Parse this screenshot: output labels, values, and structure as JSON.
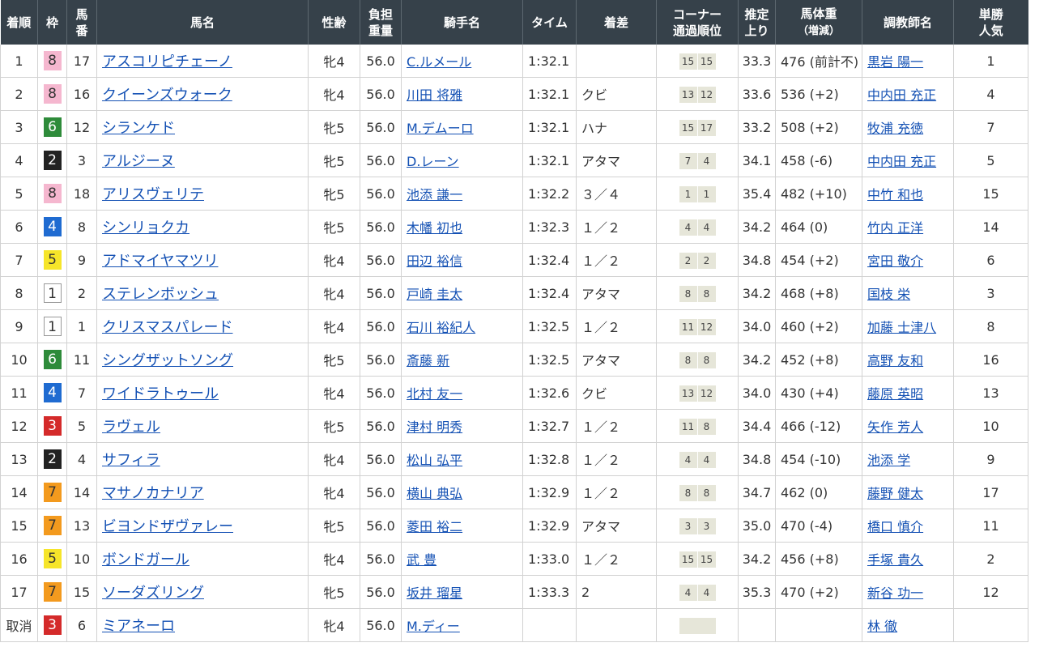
{
  "headers": {
    "rank": "着順",
    "waku": "枠",
    "num_l1": "馬",
    "num_l2": "番",
    "horse": "馬名",
    "sexage": "性齢",
    "weight_l1": "負担",
    "weight_l2": "重量",
    "jockey": "騎手名",
    "time": "タイム",
    "margin": "着差",
    "corner_l1": "コーナー",
    "corner_l2": "通過順位",
    "last3f_l1": "推定",
    "last3f_l2": "上り",
    "bodyweight_l1": "馬体重",
    "bodyweight_l2": "（増減）",
    "trainer": "調教師名",
    "pop_l1": "単勝",
    "pop_l2": "人気"
  },
  "rows": [
    {
      "rank": "1",
      "waku": "8",
      "num": "17",
      "horse": "アスコリピチェーノ",
      "sexage": "牝4",
      "weight": "56.0",
      "jockey": "C.ルメール",
      "time": "1:32.1",
      "margin": "",
      "c1": "15",
      "c2": "15",
      "last3f": "33.3",
      "bodyweight": "476 (前計不)",
      "trainer": "黒岩 陽一",
      "pop": "1"
    },
    {
      "rank": "2",
      "waku": "8",
      "num": "16",
      "horse": "クイーンズウォーク",
      "sexage": "牝4",
      "weight": "56.0",
      "jockey": "川田 将雅",
      "time": "1:32.1",
      "margin": "クビ",
      "c1": "13",
      "c2": "12",
      "last3f": "33.6",
      "bodyweight": "536 (+2)",
      "trainer": "中内田 充正",
      "pop": "4"
    },
    {
      "rank": "3",
      "waku": "6",
      "num": "12",
      "horse": "シランケド",
      "sexage": "牝5",
      "weight": "56.0",
      "jockey": "M.デムーロ",
      "time": "1:32.1",
      "margin": "ハナ",
      "c1": "15",
      "c2": "17",
      "last3f": "33.2",
      "bodyweight": "508 (+2)",
      "trainer": "牧浦 充徳",
      "pop": "7"
    },
    {
      "rank": "4",
      "waku": "2",
      "num": "3",
      "horse": "アルジーヌ",
      "sexage": "牝5",
      "weight": "56.0",
      "jockey": "D.レーン",
      "time": "1:32.1",
      "margin": "アタマ",
      "c1": "7",
      "c2": "4",
      "last3f": "34.1",
      "bodyweight": "458 (-6)",
      "trainer": "中内田 充正",
      "pop": "5"
    },
    {
      "rank": "5",
      "waku": "8",
      "num": "18",
      "horse": "アリスヴェリテ",
      "sexage": "牝5",
      "weight": "56.0",
      "jockey": "池添 謙一",
      "time": "1:32.2",
      "margin": "３／４",
      "c1": "1",
      "c2": "1",
      "last3f": "35.4",
      "bodyweight": "482 (+10)",
      "trainer": "中竹 和也",
      "pop": "15"
    },
    {
      "rank": "6",
      "waku": "4",
      "num": "8",
      "horse": "シンリョクカ",
      "sexage": "牝5",
      "weight": "56.0",
      "jockey": "木幡 初也",
      "time": "1:32.3",
      "margin": "１／２",
      "c1": "4",
      "c2": "4",
      "last3f": "34.2",
      "bodyweight": "464 (0)",
      "trainer": "竹内 正洋",
      "pop": "14"
    },
    {
      "rank": "7",
      "waku": "5",
      "num": "9",
      "horse": "アドマイヤマツリ",
      "sexage": "牝4",
      "weight": "56.0",
      "jockey": "田辺 裕信",
      "time": "1:32.4",
      "margin": "１／２",
      "c1": "2",
      "c2": "2",
      "last3f": "34.8",
      "bodyweight": "454 (+2)",
      "trainer": "宮田 敬介",
      "pop": "6"
    },
    {
      "rank": "8",
      "waku": "1",
      "num": "2",
      "horse": "ステレンボッシュ",
      "sexage": "牝4",
      "weight": "56.0",
      "jockey": "戸崎 圭太",
      "time": "1:32.4",
      "margin": "アタマ",
      "c1": "8",
      "c2": "8",
      "last3f": "34.2",
      "bodyweight": "468 (+8)",
      "trainer": "国枝 栄",
      "pop": "3"
    },
    {
      "rank": "9",
      "waku": "1",
      "num": "1",
      "horse": "クリスマスパレード",
      "sexage": "牝4",
      "weight": "56.0",
      "jockey": "石川 裕紀人",
      "time": "1:32.5",
      "margin": "１／２",
      "c1": "11",
      "c2": "12",
      "last3f": "34.0",
      "bodyweight": "460 (+2)",
      "trainer": "加藤 士津八",
      "pop": "8"
    },
    {
      "rank": "10",
      "waku": "6",
      "num": "11",
      "horse": "シングザットソング",
      "sexage": "牝5",
      "weight": "56.0",
      "jockey": "斎藤 新",
      "time": "1:32.5",
      "margin": "アタマ",
      "c1": "8",
      "c2": "8",
      "last3f": "34.2",
      "bodyweight": "452 (+8)",
      "trainer": "高野 友和",
      "pop": "16"
    },
    {
      "rank": "11",
      "waku": "4",
      "num": "7",
      "horse": "ワイドラトゥール",
      "sexage": "牝4",
      "weight": "56.0",
      "jockey": "北村 友一",
      "time": "1:32.6",
      "margin": "クビ",
      "c1": "13",
      "c2": "12",
      "last3f": "34.0",
      "bodyweight": "430 (+4)",
      "trainer": "藤原 英昭",
      "pop": "13"
    },
    {
      "rank": "12",
      "waku": "3",
      "num": "5",
      "horse": "ラヴェル",
      "sexage": "牝5",
      "weight": "56.0",
      "jockey": "津村 明秀",
      "time": "1:32.7",
      "margin": "１／２",
      "c1": "11",
      "c2": "8",
      "last3f": "34.4",
      "bodyweight": "466 (-12)",
      "trainer": "矢作 芳人",
      "pop": "10"
    },
    {
      "rank": "13",
      "waku": "2",
      "num": "4",
      "horse": "サフィラ",
      "sexage": "牝4",
      "weight": "56.0",
      "jockey": "松山 弘平",
      "time": "1:32.8",
      "margin": "１／２",
      "c1": "4",
      "c2": "4",
      "last3f": "34.8",
      "bodyweight": "454 (-10)",
      "trainer": "池添 学",
      "pop": "9"
    },
    {
      "rank": "14",
      "waku": "7",
      "num": "14",
      "horse": "マサノカナリア",
      "sexage": "牝4",
      "weight": "56.0",
      "jockey": "横山 典弘",
      "time": "1:32.9",
      "margin": "１／２",
      "c1": "8",
      "c2": "8",
      "last3f": "34.7",
      "bodyweight": "462 (0)",
      "trainer": "藤野 健太",
      "pop": "17"
    },
    {
      "rank": "15",
      "waku": "7",
      "num": "13",
      "horse": "ビヨンドザヴァレー",
      "sexage": "牝5",
      "weight": "56.0",
      "jockey": "菱田 裕二",
      "time": "1:32.9",
      "margin": "アタマ",
      "c1": "3",
      "c2": "3",
      "last3f": "35.0",
      "bodyweight": "470 (-4)",
      "trainer": "橋口 慎介",
      "pop": "11"
    },
    {
      "rank": "16",
      "waku": "5",
      "num": "10",
      "horse": "ボンドガール",
      "sexage": "牝4",
      "weight": "56.0",
      "jockey": "武 豊",
      "time": "1:33.0",
      "margin": "１／２",
      "c1": "15",
      "c2": "15",
      "last3f": "34.2",
      "bodyweight": "456 (+8)",
      "trainer": "手塚 貴久",
      "pop": "2"
    },
    {
      "rank": "17",
      "waku": "7",
      "num": "15",
      "horse": "ソーダズリング",
      "sexage": "牝5",
      "weight": "56.0",
      "jockey": "坂井 瑠星",
      "time": "1:33.3",
      "margin": "2",
      "c1": "4",
      "c2": "4",
      "last3f": "35.3",
      "bodyweight": "470 (+2)",
      "trainer": "新谷 功一",
      "pop": "12"
    },
    {
      "rank": "取消",
      "waku": "3",
      "num": "6",
      "horse": "ミアネーロ",
      "sexage": "牝4",
      "weight": "56.0",
      "jockey": "M.ディー",
      "time": "",
      "margin": "",
      "c1": "",
      "c2": "",
      "last3f": "",
      "bodyweight": "",
      "trainer": "林 徹",
      "pop": ""
    }
  ]
}
